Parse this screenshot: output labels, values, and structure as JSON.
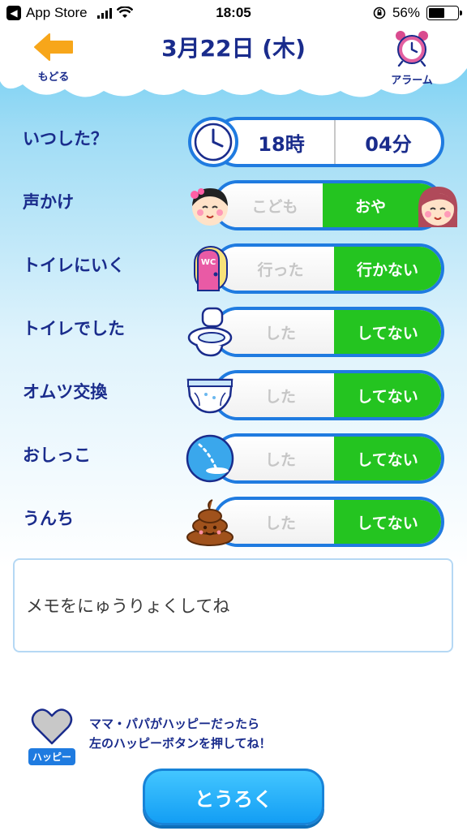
{
  "status_bar": {
    "back_app": "App Store",
    "time": "18:05",
    "battery": "56%"
  },
  "header": {
    "title": "3月22日 (木)",
    "back_label": "もどる",
    "alarm_label": "アラーム"
  },
  "time_row": {
    "label": "いつした？",
    "hour": "18時",
    "minute": "04分"
  },
  "rows": [
    {
      "label": "声かけ",
      "icon": "child-face-icon",
      "left": "こども",
      "right": "おや",
      "selected": "right",
      "right_icon": "parent-face-icon"
    },
    {
      "label": "トイレにいく",
      "icon": "toilet-door-icon",
      "icon_text": "WC",
      "left": "行った",
      "right": "行かない",
      "selected": "right"
    },
    {
      "label": "トイレでした",
      "icon": "toilet-icon",
      "left": "した",
      "right": "してない",
      "selected": "right"
    },
    {
      "label": "オムツ交換",
      "icon": "diaper-icon",
      "left": "した",
      "right": "してない",
      "selected": "right"
    },
    {
      "label": "おしっこ",
      "icon": "pee-drop-icon",
      "left": "した",
      "right": "してない",
      "selected": "right"
    },
    {
      "label": "うんち",
      "icon": "poop-icon",
      "left": "した",
      "right": "してない",
      "selected": "right"
    }
  ],
  "memo": {
    "placeholder": "メモをにゅうりょくしてね"
  },
  "happy": {
    "label": "ハッピー",
    "text_line1": "ママ・パパがハッピーだったら",
    "text_line2": "左のハッピーボタンを押してね！"
  },
  "register_label": "とうろく",
  "colors": {
    "accent_blue": "#1f7be0",
    "selected_green": "#24c420",
    "text_navy": "#1a2c8c"
  }
}
